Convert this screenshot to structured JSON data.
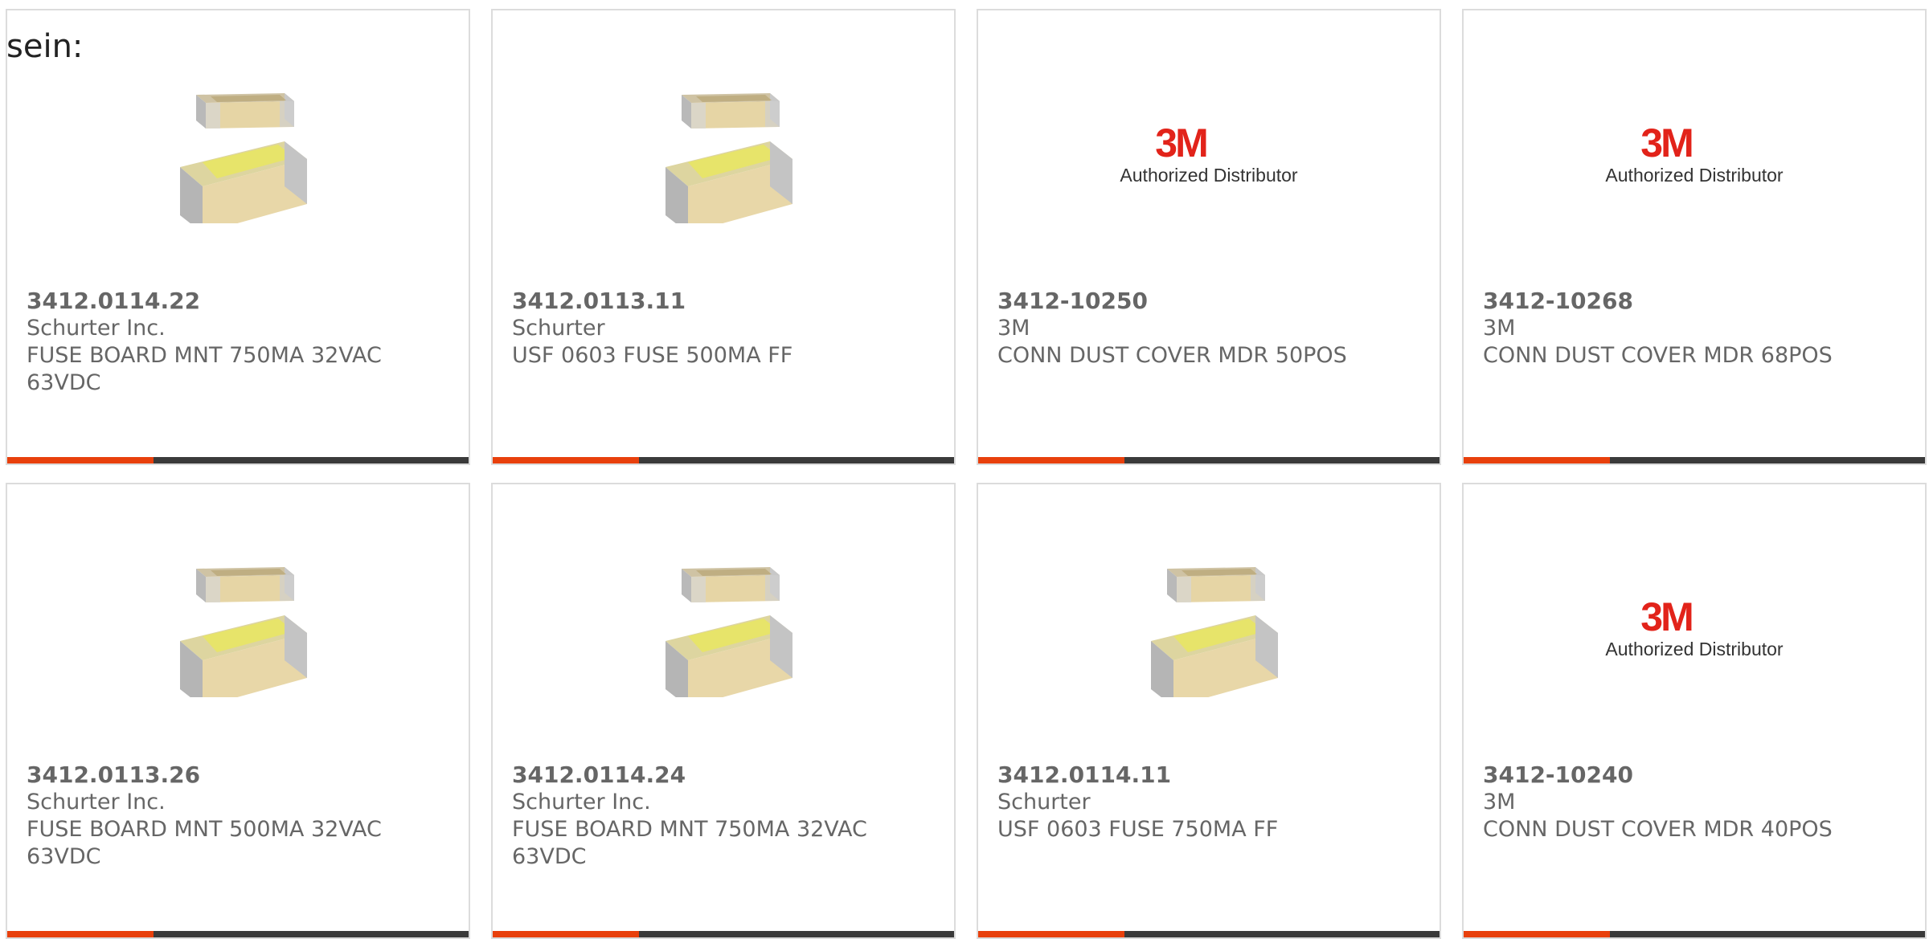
{
  "heading": "sein:",
  "colors": {
    "accent": "#e8400c",
    "bar_dark": "#3a3a3a",
    "text": "#666666",
    "logo_red": "#e2231a"
  },
  "products": [
    {
      "part": "3412.0114.22",
      "manufacturer": "Schurter Inc.",
      "description": "FUSE BOARD MNT 750MA 32VAC 63VDC",
      "image": "smd-fuse-icon"
    },
    {
      "part": "3412.0113.11",
      "manufacturer": "Schurter",
      "description": "USF 0603 FUSE 500MA FF",
      "image": "smd-fuse-icon"
    },
    {
      "part": "3412-10250",
      "manufacturer": "3M",
      "description": "CONN DUST COVER MDR 50POS",
      "image": "3m-logo"
    },
    {
      "part": "3412-10268",
      "manufacturer": "3M",
      "description": "CONN DUST COVER MDR 68POS",
      "image": "3m-logo"
    },
    {
      "part": "3412.0113.26",
      "manufacturer": "Schurter Inc.",
      "description": "FUSE BOARD MNT 500MA 32VAC 63VDC",
      "image": "smd-fuse-icon"
    },
    {
      "part": "3412.0114.24",
      "manufacturer": "Schurter Inc.",
      "description": "FUSE BOARD MNT 750MA 32VAC 63VDC",
      "image": "smd-fuse-icon"
    },
    {
      "part": "3412.0114.11",
      "manufacturer": "Schurter",
      "description": "USF 0603 FUSE 750MA FF",
      "image": "smd-fuse-icon"
    },
    {
      "part": "3412-10240",
      "manufacturer": "3M",
      "description": "CONN DUST COVER MDR 40POS",
      "image": "3m-logo"
    }
  ],
  "logo": {
    "mark": "3M",
    "tagline": "Authorized Distributor"
  }
}
